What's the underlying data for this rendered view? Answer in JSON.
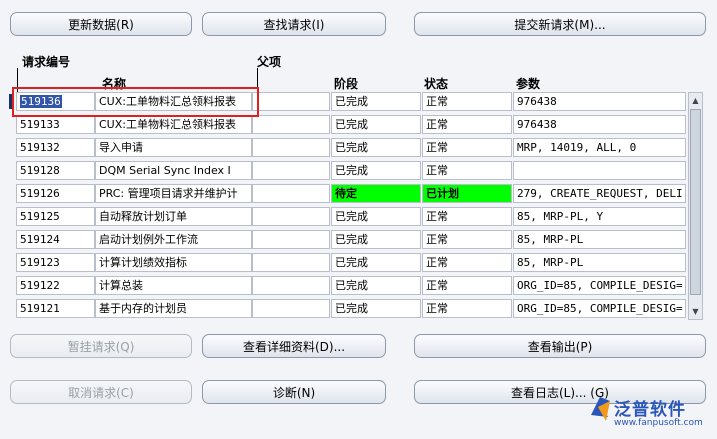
{
  "buttons": {
    "refresh": "更新数据(R)",
    "find": "查找请求(I)",
    "submit_new": "提交新请求(M)...",
    "hold": "暂挂请求(Q)",
    "view_details": "查看详细资料(D)...",
    "view_output": "查看输出(P)",
    "cancel": "取消请求(C)",
    "diagnose": "诊断(N)",
    "view_log": "查看日志(L)...  (G)"
  },
  "headers": {
    "request_id": "请求编号",
    "parent": "父项",
    "name": "名称",
    "phase": "阶段",
    "status": "状态",
    "params": "参数"
  },
  "rows": [
    {
      "id": "519136",
      "name": "CUX:工单物料汇总领料报表",
      "parent": "",
      "phase": "已完成",
      "status": "正常",
      "params": "976438",
      "selected": true
    },
    {
      "id": "519133",
      "name": "CUX:工单物料汇总领料报表",
      "parent": "",
      "phase": "已完成",
      "status": "正常",
      "params": "976438"
    },
    {
      "id": "519132",
      "name": "导入申请",
      "parent": "",
      "phase": "已完成",
      "status": "正常",
      "params": "MRP, 14019, ALL, 0"
    },
    {
      "id": "519128",
      "name": "DQM Serial Sync Index I",
      "parent": "",
      "phase": "已完成",
      "status": "正常",
      "params": ""
    },
    {
      "id": "519126",
      "name": "PRC: 管理项目请求并维护计",
      "parent": "",
      "phase": "待定",
      "status": "已计划",
      "params": "279, CREATE_REQUEST, DELI",
      "highlight": true
    },
    {
      "id": "519125",
      "name": "自动释放计划订单",
      "parent": "",
      "phase": "已完成",
      "status": "正常",
      "params": "85, MRP-PL, Y"
    },
    {
      "id": "519124",
      "name": "启动计划例外工作流",
      "parent": "",
      "phase": "已完成",
      "status": "正常",
      "params": "85, MRP-PL"
    },
    {
      "id": "519123",
      "name": "计算计划绩效指标",
      "parent": "",
      "phase": "已完成",
      "status": "正常",
      "params": "85, MRP-PL"
    },
    {
      "id": "519122",
      "name": "计算总装",
      "parent": "",
      "phase": "已完成",
      "status": "正常",
      "params": "ORG_ID=85, COMPILE_DESIG="
    },
    {
      "id": "519121",
      "name": "基于内存的计划员",
      "parent": "",
      "phase": "已完成",
      "status": "正常",
      "params": "ORG_ID=85, COMPILE_DESIG="
    }
  ],
  "watermark": {
    "brand": "泛普软件",
    "url": "www.fanpusoft.com"
  },
  "colors": {
    "highlight": "#00ff00",
    "annotation": "#e02020",
    "selection": "#3155a8"
  }
}
